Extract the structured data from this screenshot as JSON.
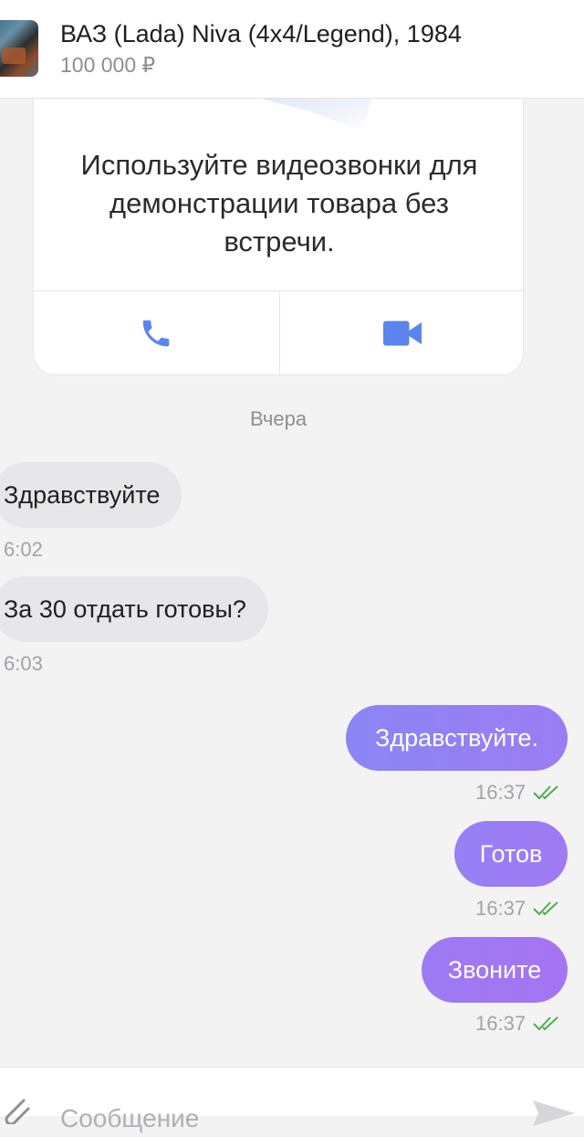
{
  "header": {
    "title": "ВАЗ (Lada) Niva (4x4/Legend), 1984",
    "price": "100 000 ₽"
  },
  "promo": {
    "text": "Используйте видеозвонки для демонстрации товара без встречи.",
    "call_icon": "phone-icon",
    "video_icon": "video-camera-icon",
    "accent_color": "#5b84ee"
  },
  "day_separator": "Вчера",
  "messages": [
    {
      "direction": "in",
      "text": "Здравствуйте",
      "time": "6:02"
    },
    {
      "direction": "in",
      "text": "За 30 отдать готовы?",
      "time": "6:03"
    },
    {
      "direction": "out",
      "text": "Здравствуйте.",
      "time": "16:37",
      "status": "read"
    },
    {
      "direction": "out",
      "text": "Готов",
      "time": "16:37",
      "status": "read"
    },
    {
      "direction": "out",
      "text": "Звоните",
      "time": "16:37",
      "status": "read"
    }
  ],
  "composer": {
    "placeholder": "Сообщение",
    "attach_icon": "paperclip-icon",
    "send_icon": "send-icon"
  },
  "colors": {
    "incoming_bubble": "#e7e7e9",
    "outgoing_bubble_start": "#8b85f5",
    "outgoing_bubble_end": "#a574f2",
    "read_ticks": "#4caf50"
  }
}
